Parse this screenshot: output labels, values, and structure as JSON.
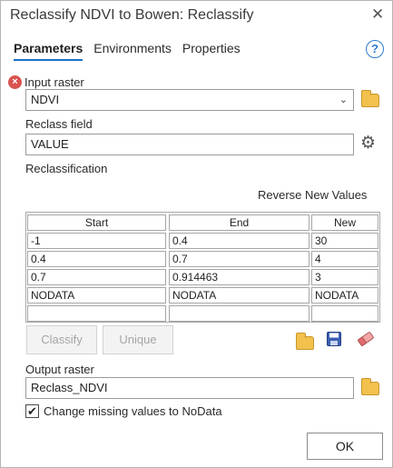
{
  "window": {
    "title": "Reclassify NDVI to Bowen: Reclassify",
    "close_glyph": "✕"
  },
  "tabs": [
    {
      "label": "Parameters",
      "active": true
    },
    {
      "label": "Environments",
      "active": false
    },
    {
      "label": "Properties",
      "active": false
    }
  ],
  "help_glyph": "?",
  "input_raster": {
    "label": "Input raster",
    "value": "NDVI",
    "error_glyph": "×"
  },
  "reclass_field": {
    "label": "Reclass field",
    "value": "VALUE"
  },
  "reclassification": {
    "label": "Reclassification",
    "reverse_label": "Reverse New Values",
    "columns": [
      "Start",
      "End",
      "New"
    ],
    "rows": [
      [
        "-1",
        "0.4",
        "30"
      ],
      [
        "0.4",
        "0.7",
        "4"
      ],
      [
        "0.7",
        "0.914463",
        "3"
      ],
      [
        "NODATA",
        "NODATA",
        "NODATA"
      ],
      [
        "",
        "",
        ""
      ]
    ],
    "classify_label": "Classify",
    "unique_label": "Unique"
  },
  "output_raster": {
    "label": "Output raster",
    "value": "Reclass_NDVI"
  },
  "missing_values": {
    "label": "Change missing values to NoData",
    "checked": true,
    "check_glyph": "✔"
  },
  "ok_label": "OK",
  "icons": {
    "folder": "folder-icon",
    "gear": "gear-icon",
    "save": "save-icon",
    "eraser": "eraser-icon",
    "error": "error-icon",
    "help": "help-icon",
    "close": "close-icon"
  },
  "colors": {
    "accent": "#1f72c6",
    "error": "#d9534f",
    "folder": "#f2c14e"
  }
}
